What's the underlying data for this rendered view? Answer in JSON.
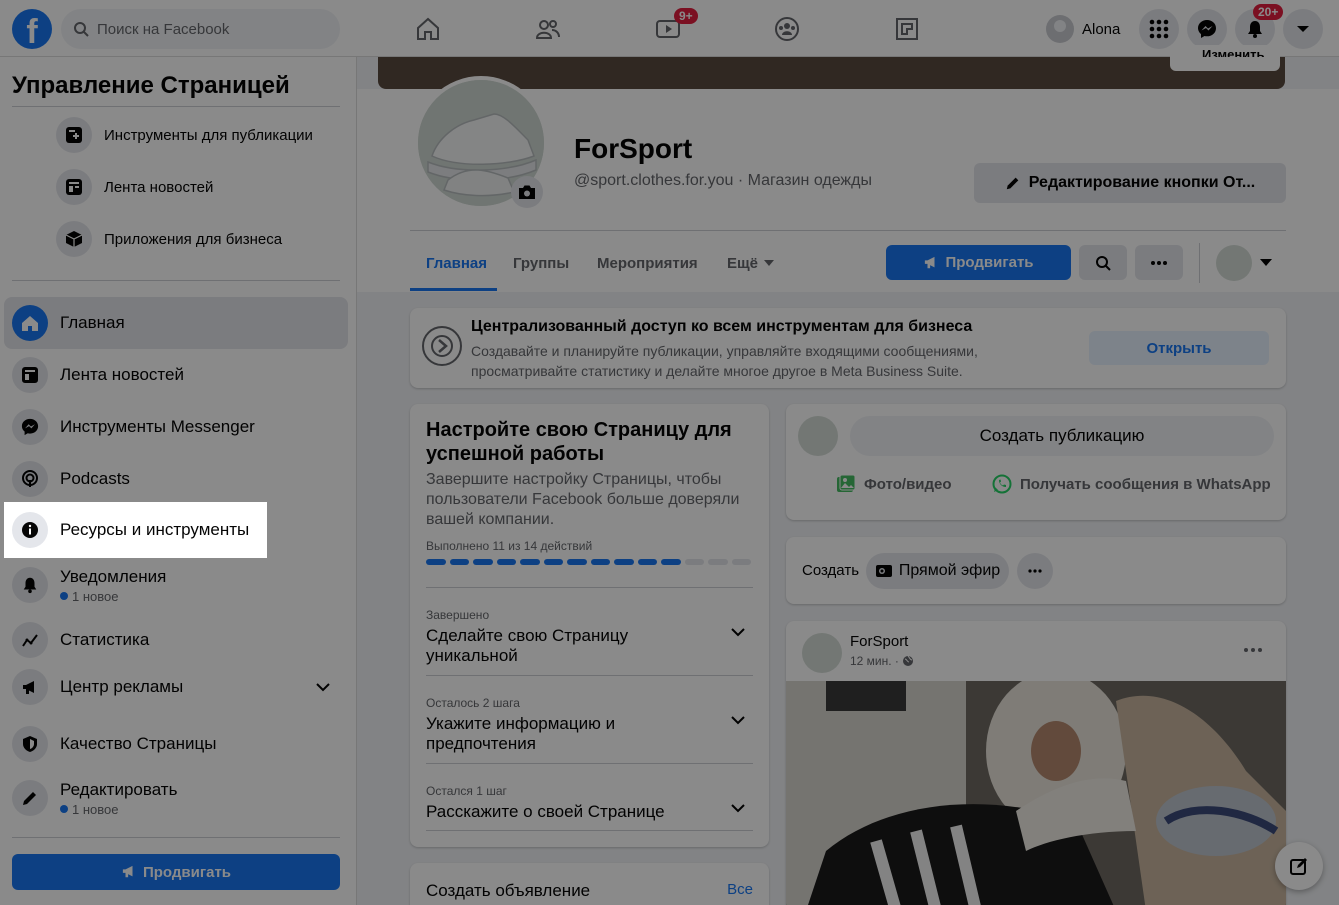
{
  "topbar": {
    "logo": "f",
    "search_placeholder": "Поиск на Facebook",
    "watch_badge": "9+",
    "user_name": "Alona",
    "notifications_badge": "20+"
  },
  "cover": {
    "edit_label": "Изменить"
  },
  "sidebar": {
    "title": "Управление Страницей",
    "sub_items": [
      {
        "label": "Инструменты для публикации",
        "icon": "publishing-tools-icon"
      },
      {
        "label": "Лента новостей",
        "icon": "news-feed-icon"
      },
      {
        "label": "Приложения для бизнеса",
        "icon": "business-apps-icon"
      }
    ],
    "items": [
      {
        "label": "Главная",
        "icon": "home-icon"
      },
      {
        "label": "Лента новостей",
        "icon": "news-feed-icon"
      },
      {
        "label": "Инструменты Messenger",
        "icon": "messenger-icon"
      },
      {
        "label": "Podcasts",
        "icon": "podcast-icon"
      },
      {
        "label": "Ресурсы и инструменты",
        "icon": "info-icon"
      },
      {
        "label": "Уведомления",
        "sub": "1 новое",
        "icon": "bell-icon"
      },
      {
        "label": "Статистика",
        "icon": "insights-icon"
      },
      {
        "label": "Центр рекламы",
        "icon": "megaphone-icon"
      },
      {
        "label": "Качество Страницы",
        "icon": "shield-icon"
      },
      {
        "label": "Редактировать",
        "sub": "1 новое",
        "icon": "pencil-icon"
      }
    ],
    "promote_label": "Продвигать"
  },
  "page": {
    "name": "ForSport",
    "handle": "@sport.clothes.for.you · Магазин одежды",
    "edit_button": "Редактирование кнопки От...",
    "tabs": [
      "Главная",
      "Группы",
      "Мероприятия",
      "Ещё"
    ],
    "promote_label": "Продвигать"
  },
  "mbs": {
    "title": "Централизованный доступ ко всем инструментам для бизнеса",
    "text": "Создавайте и планируйте публикации, управляйте входящими сообщениями, просматривайте статистику и делайте многое другое в Meta Business Suite.",
    "button": "Открыть"
  },
  "setup": {
    "title": "Настройте свою Страницу для успешной работы",
    "desc": "Завершите настройку Страницы, чтобы пользователи Facebook больше доверяли вашей компании.",
    "progress_label": "Выполнено 11 из 14 действий",
    "progress_done": 11,
    "progress_total": 14,
    "steps": [
      {
        "caption": "Завершено",
        "title": "Сделайте свою Страницу уникальной"
      },
      {
        "caption": "Осталось 2 шага",
        "title": "Укажите информацию и предпочтения"
      },
      {
        "caption": "Остался 1 шаг",
        "title": "Расскажите о своей Странице"
      }
    ]
  },
  "ad_card": {
    "title": "Создать объявление",
    "link": "Все"
  },
  "composer": {
    "placeholder": "Создать публикацию",
    "photo_video": "Фото/видео",
    "whatsapp": "Получать сообщения в WhatsApp"
  },
  "create_bar": {
    "label": "Создать",
    "live": "Прямой эфир"
  },
  "post": {
    "author": "ForSport",
    "time": "12 мин. ·"
  },
  "colors": {
    "accent": "#1877f2",
    "badge": "#e41e3f"
  }
}
